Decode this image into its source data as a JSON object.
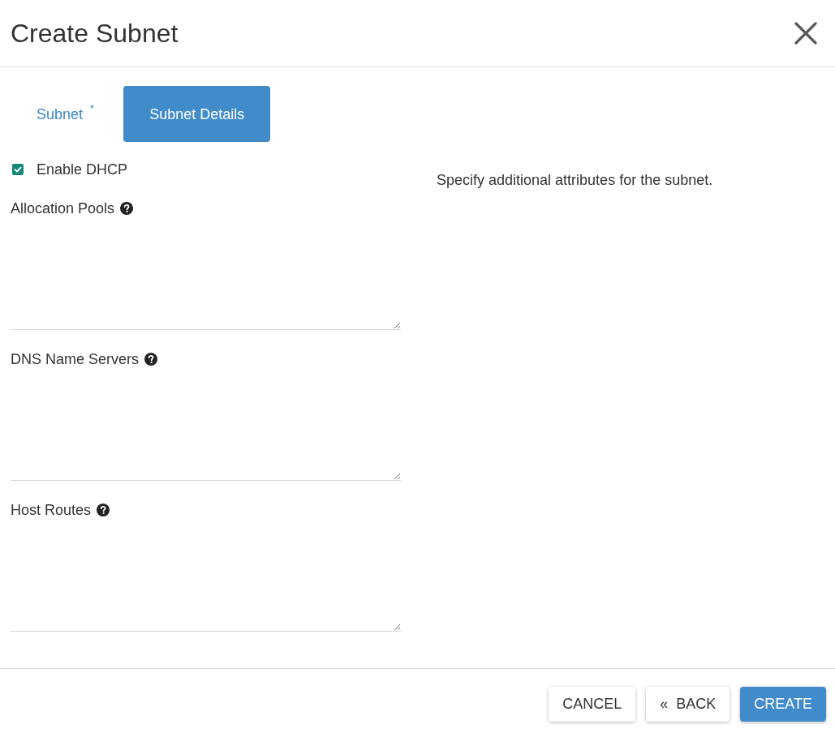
{
  "dialog": {
    "title": "Create Subnet"
  },
  "tabs": [
    {
      "label": "Subnet $^{*}$",
      "selected": false
    },
    {
      "label": "Subnet Details",
      "selected": true
    }
  ],
  "enable_dhcp": {
    "label": "Enable DHCP",
    "checked": true
  },
  "fields": [
    {
      "label": "Allocation Pools",
      "help": true
    },
    {
      "label": "DNS Name Servers",
      "help": true
    },
    {
      "label": "Host Routes",
      "help": true
    }
  ],
  "description": "Specify additional attributes for the subnet.",
  "buttons": [
    {
      "label": "CANCEL",
      "kind": "plain"
    },
    {
      "label": "«  BACK",
      "kind": "plain"
    },
    {
      "label": "CREATE",
      "kind": "primary"
    }
  ]
}
